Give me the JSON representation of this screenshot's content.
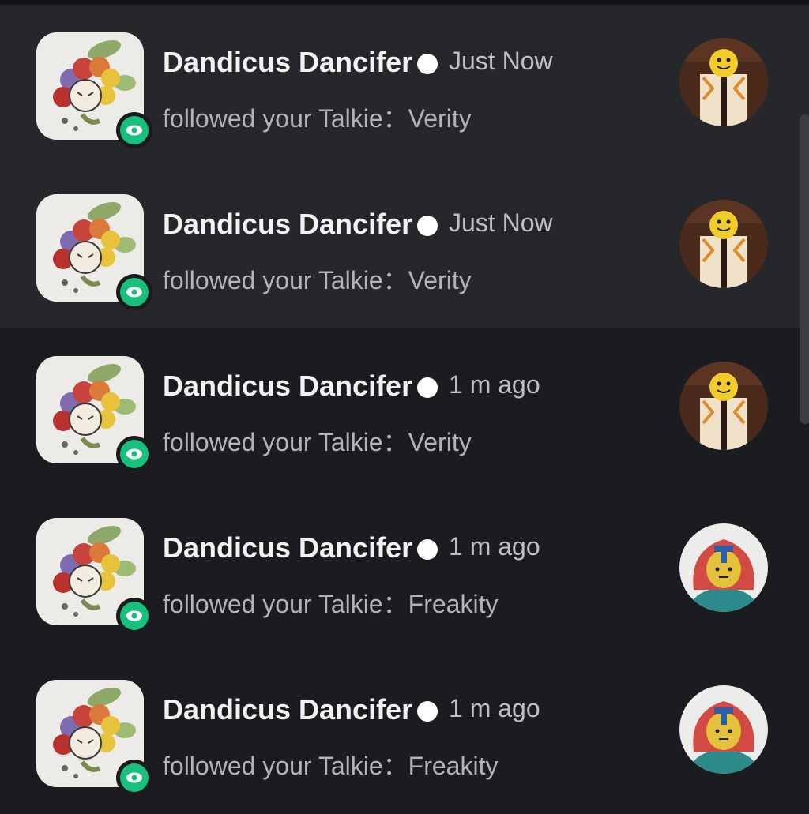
{
  "notifications": [
    {
      "user": "Dandicus Dancifer",
      "time": "Just Now",
      "action": "followed your Talkie：Verity",
      "thumbnail": "verity",
      "unread": true
    },
    {
      "user": "Dandicus Dancifer",
      "time": "Just Now",
      "action": "followed your Talkie：Verity",
      "thumbnail": "verity",
      "unread": true
    },
    {
      "user": "Dandicus Dancifer",
      "time": "1 m ago",
      "action": "followed your Talkie：Verity",
      "thumbnail": "verity",
      "unread": false
    },
    {
      "user": "Dandicus Dancifer",
      "time": "1 m ago",
      "action": "followed your Talkie：Freakity",
      "thumbnail": "freakity",
      "unread": false
    },
    {
      "user": "Dandicus Dancifer",
      "time": "1 m ago",
      "action": "followed your Talkie：Freakity",
      "thumbnail": "freakity",
      "unread": false
    }
  ],
  "icons": {
    "badge": "eye-icon",
    "status": "online-dot-icon"
  },
  "colors": {
    "background": "#1b1c20",
    "unread_background": "#26272b",
    "badge": "#18c07e",
    "name": "#f2f2f2",
    "secondary": "#b3b3b8"
  }
}
